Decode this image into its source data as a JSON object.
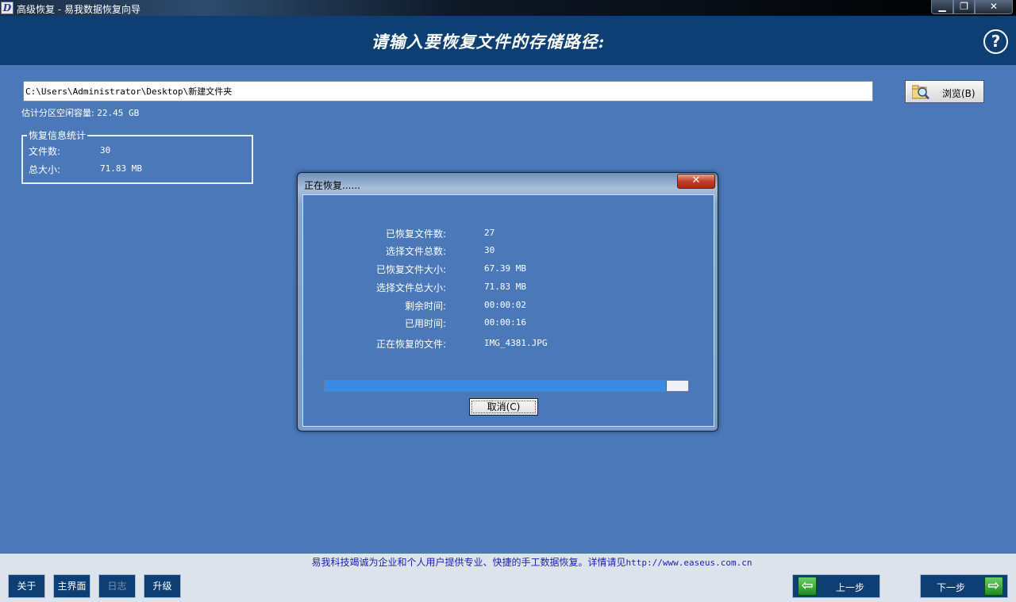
{
  "window": {
    "title": "高级恢复 - 易我数据恢复向导",
    "app_icon": "D",
    "minimize": "▁",
    "maximize": "❐",
    "close": "✕"
  },
  "header": {
    "heading": "请输入要恢复文件的存储路径:",
    "help": "?"
  },
  "path": {
    "value": "C:\\Users\\Administrator\\Desktop\\新建文件夹"
  },
  "browse": {
    "label": "浏览(B)"
  },
  "free_space": {
    "label": "估计分区空闲容量:",
    "value": "22.45 GB"
  },
  "stats": {
    "legend": "恢复信息统计",
    "file_count_label": "文件数:",
    "file_count": "30",
    "total_size_label": "总大小:",
    "total_size": "71.83 MB"
  },
  "dialog": {
    "title": "正在恢复......",
    "close": "✕",
    "rows": [
      {
        "label": "已恢复文件数:",
        "value": "27"
      },
      {
        "label": "选择文件总数:",
        "value": "30"
      },
      {
        "label": "已恢复文件大小:",
        "value": "67.39 MB"
      },
      {
        "label": "选择文件总大小:",
        "value": "71.83 MB"
      },
      {
        "label": "剩余时间:",
        "value": "00:00:02"
      },
      {
        "label": "已用时间:",
        "value": "00:00:16"
      },
      {
        "label": "正在恢复的文件:",
        "value": "IMG_4381.JPG"
      }
    ],
    "progress_percent": 94,
    "cancel": "取消(C)"
  },
  "footer": {
    "slogan": "易我科技竭诚为企业和个人用户提供专业、快捷的手工数据恢复。详情请见",
    "url": "http://www.easeus.com.cn",
    "about": "关于",
    "main": "主界面",
    "log": "日志",
    "upgrade": "升级",
    "prev": "上一步",
    "next": "下一步",
    "prev_arrow": "⇦",
    "next_arrow": "⇨"
  }
}
